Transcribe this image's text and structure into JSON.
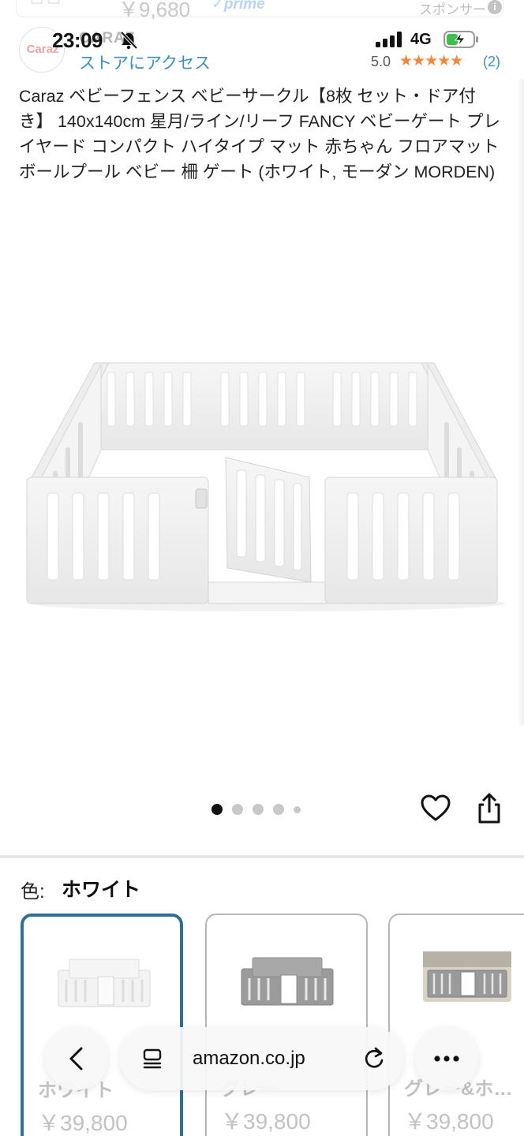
{
  "ghost": {
    "price": "￥9,680",
    "prime": "✓prime",
    "sponsored": "スポンサー",
    "info": "i"
  },
  "status_bar": {
    "time": "23:09",
    "network": "4G"
  },
  "store": {
    "logo_text": "Caraz",
    "name": "CARAZ",
    "link": "ストアにアクセス",
    "rating": "5.0",
    "stars": "★★★★★",
    "review_count": "(2)"
  },
  "product": {
    "title": "Caraz ベビーフェンス ベビーサークル【8枚 セット・ドア付き】 140x140cm 星月/ライン/リーフ FANCY ベビーゲート プレイヤード コンパクト ハイタイプ マット 赤ちゃん フロアマット ボールプール ベビー 柵 ゲート (ホワイト, モーダン MORDEN)",
    "image_count": 5,
    "current_image": 1
  },
  "variant": {
    "label": "色:",
    "selected": "ホワイト",
    "options": [
      {
        "name": "ホワイト",
        "price": "￥39,800"
      },
      {
        "name": "グレー",
        "price": "￥39,800"
      },
      {
        "name": "グレー&ホ…",
        "price": "￥39,800"
      }
    ]
  },
  "browser": {
    "address": "amazon.co.jp"
  },
  "colors": {
    "link": "#3d8fb6",
    "star": "#f1883c",
    "selected_border": "#2f6f94"
  },
  "icons": [
    "bell-muted-icon",
    "signal-icon",
    "battery-charging-icon",
    "heart-icon",
    "share-icon",
    "back-chevron-icon",
    "tabs-icon",
    "reload-icon",
    "more-icon"
  ]
}
